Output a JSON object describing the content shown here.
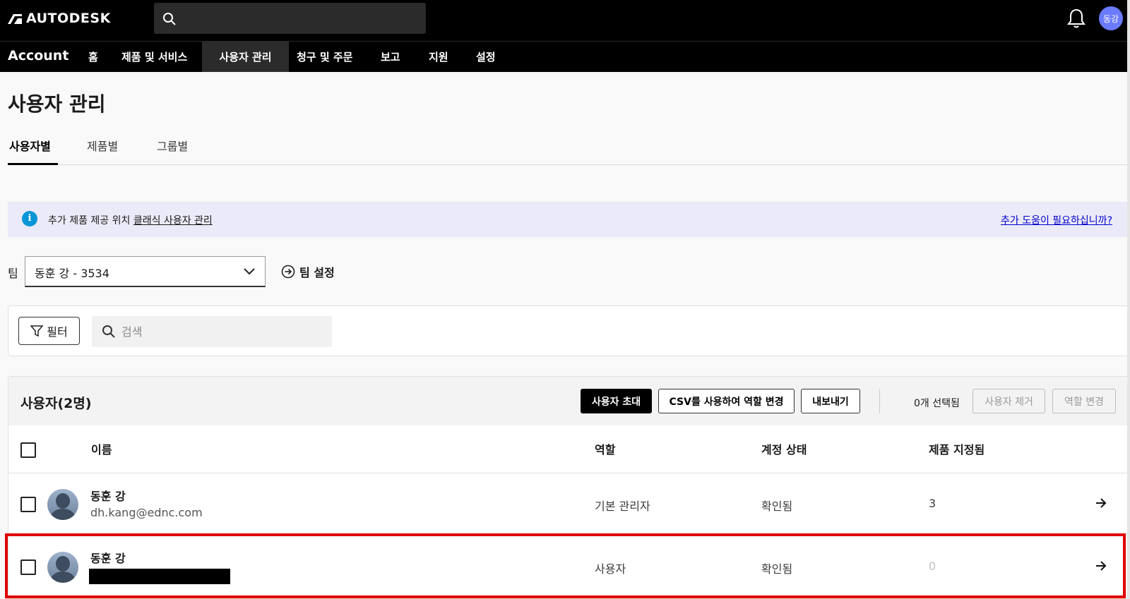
{
  "brand": {
    "logo_text": "AUTODESK",
    "app_name": "Account"
  },
  "top": {
    "user_initials": "동강"
  },
  "nav": [
    {
      "label": "홈"
    },
    {
      "label": "제품 및 서비스"
    },
    {
      "label": "사용자 관리"
    },
    {
      "label": "청구 및 주문"
    },
    {
      "label": "보고"
    },
    {
      "label": "지원"
    },
    {
      "label": "설정"
    }
  ],
  "page": {
    "title": "사용자 관리"
  },
  "tabs": [
    {
      "label": "사용자별"
    },
    {
      "label": "제품별"
    },
    {
      "label": "그룹별"
    }
  ],
  "banner": {
    "icon": "i",
    "text_prefix": "추가 제품 제공 위치",
    "link": "클래식 사용자 관리",
    "help_link": "추가 도움이 필요하십니까?"
  },
  "team": {
    "label": "팀",
    "selected": "동훈 강 - 3534",
    "settings_label": "팀 설정"
  },
  "filter": {
    "button_label": "필터",
    "search_placeholder": "검색"
  },
  "users": {
    "count_label": "사용자(2명)",
    "actions": {
      "invite": "사용자 초대",
      "csv_roles": "CSV를 사용하여 역할 변경",
      "export": "내보내기",
      "selected": "0개 선택됨",
      "remove": "사용자 제거",
      "change_role": "역할 변경"
    },
    "columns": {
      "name": "이름",
      "role": "역할",
      "status": "계정 상태",
      "products": "제품 지정됨"
    },
    "rows": [
      {
        "name": "동훈 강",
        "email": "dh.kang@ednc.com",
        "role": "기본 관리자",
        "status": "확인됨",
        "products": "3"
      },
      {
        "name": "동훈 강",
        "email": "",
        "role": "사용자",
        "status": "확인됨",
        "products": "0"
      }
    ]
  },
  "colors": {
    "accent_blue": "#0696d7",
    "highlight_red": "#e00000",
    "banner_bg": "#ebeaf8"
  }
}
